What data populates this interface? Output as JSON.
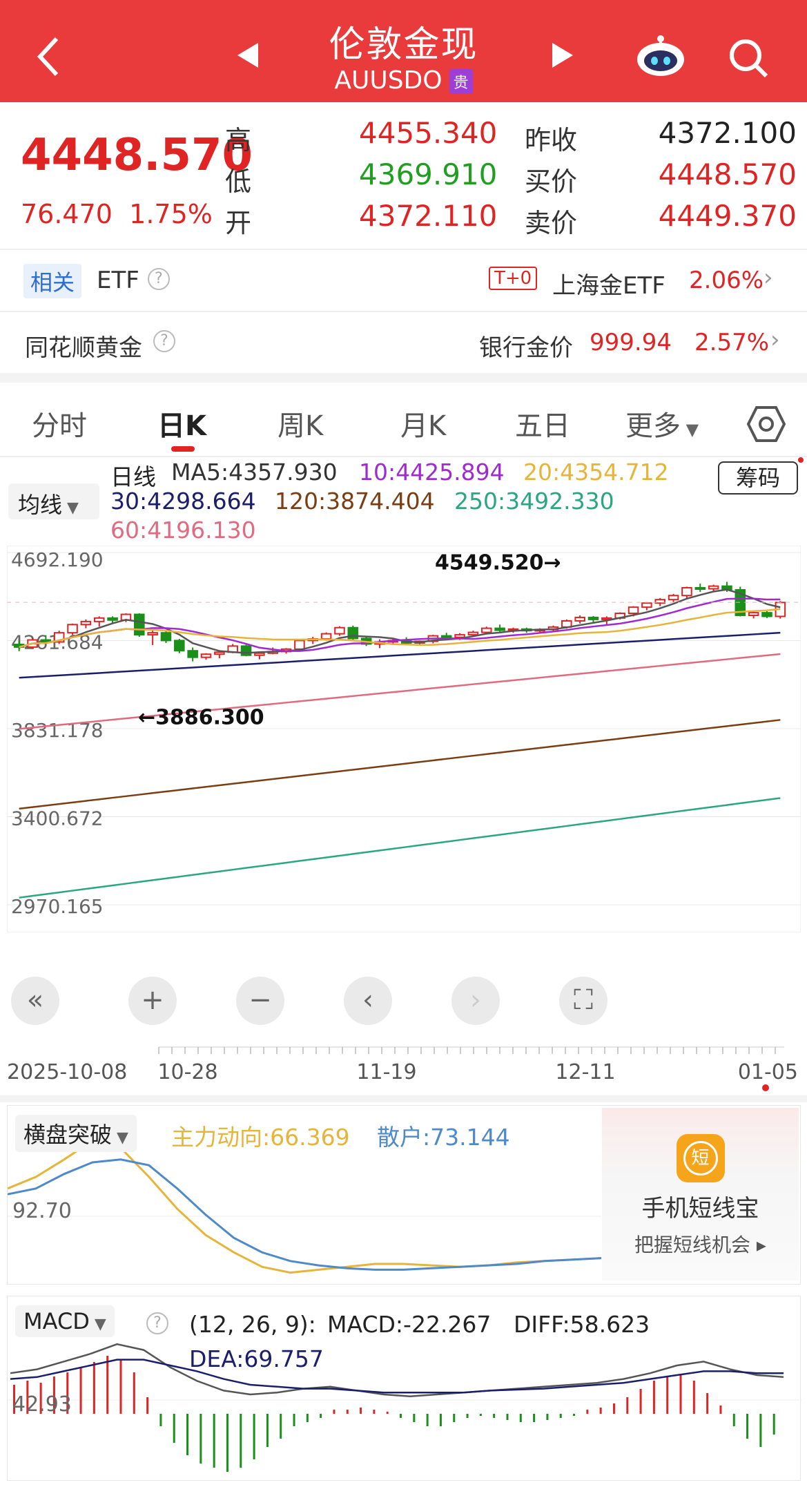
{
  "header": {
    "title": "伦敦金现",
    "code": "AUUSDO",
    "tag": "贵",
    "back_icon": "chevron-left",
    "prev_icon": "triangle-left",
    "next_icon": "triangle-right",
    "assistant_icon": "robot",
    "search_icon": "search"
  },
  "quote": {
    "price": "4448.570",
    "change": "76.470",
    "change_pct": "1.75%",
    "high_label": "高",
    "high": "4455.340",
    "low_label": "低",
    "low": "4369.910",
    "open_label": "开",
    "open": "4372.110",
    "prev_close_label": "昨收",
    "prev_close": "4372.100",
    "bid_label": "买价",
    "bid": "4448.570",
    "ask_label": "卖价",
    "ask": "4449.370"
  },
  "related": {
    "tag": "相关",
    "label": "ETF",
    "t0": "T+0",
    "etf_name": "上海金ETF",
    "etf_pct": "2.06%"
  },
  "gold": {
    "label": "同花顺黄金",
    "bank_label": "银行金价",
    "bank_price": "999.94",
    "bank_pct": "2.57%"
  },
  "tabs": [
    "分时",
    "日K",
    "周K",
    "月K",
    "五日",
    "更多"
  ],
  "active_tab": "日K",
  "ma": {
    "kind": "日线",
    "selector": "均线",
    "ma5": "MA5:4357.930",
    "ma10": "10:4425.894",
    "ma20": "20:4354.712",
    "ma30": "30:4298.664",
    "ma120": "120:3874.404",
    "ma250": "250:3492.330",
    "ma60": "60:4196.130",
    "chouma": "筹码"
  },
  "chart_data": {
    "type": "candlestick",
    "y_ticks": [
      "4692.190",
      "4261.684",
      "3831.178",
      "3400.672",
      "2970.165"
    ],
    "x_ticks": [
      "2025-10-08",
      "10-28",
      "11-19",
      "12-11",
      "01-05"
    ],
    "annotations": {
      "high": "4549.520→",
      "low": "←3886.300"
    },
    "ylim": [
      2970.165,
      4692.19
    ],
    "candles": [
      [
        4243,
        4260,
        4210,
        4230
      ],
      [
        4230,
        4275,
        4222,
        4265
      ],
      [
        4265,
        4288,
        4250,
        4255
      ],
      [
        4255,
        4310,
        4245,
        4300
      ],
      [
        4300,
        4345,
        4290,
        4340
      ],
      [
        4340,
        4365,
        4322,
        4355
      ],
      [
        4355,
        4380,
        4330,
        4372
      ],
      [
        4372,
        4380,
        4345,
        4362
      ],
      [
        4362,
        4395,
        4352,
        4390
      ],
      [
        4390,
        4395,
        4280,
        4290
      ],
      [
        4290,
        4310,
        4240,
        4300
      ],
      [
        4300,
        4310,
        4250,
        4262
      ],
      [
        4262,
        4270,
        4200,
        4212
      ],
      [
        4212,
        4228,
        4160,
        4180
      ],
      [
        4180,
        4200,
        4168,
        4195
      ],
      [
        4195,
        4215,
        4175,
        4205
      ],
      [
        4205,
        4245,
        4200,
        4235
      ],
      [
        4235,
        4245,
        4185,
        4190
      ],
      [
        4190,
        4205,
        4170,
        4200
      ],
      [
        4200,
        4228,
        4195,
        4208
      ],
      [
        4208,
        4225,
        4198,
        4220
      ],
      [
        4220,
        4270,
        4210,
        4262
      ],
      [
        4262,
        4280,
        4245,
        4270
      ],
      [
        4270,
        4302,
        4262,
        4295
      ],
      [
        4295,
        4332,
        4285,
        4325
      ],
      [
        4325,
        4335,
        4265,
        4272
      ],
      [
        4272,
        4285,
        4235,
        4245
      ],
      [
        4245,
        4268,
        4225,
        4255
      ],
      [
        4255,
        4272,
        4240,
        4262
      ],
      [
        4262,
        4278,
        4245,
        4250
      ],
      [
        4250,
        4262,
        4238,
        4258
      ],
      [
        4258,
        4290,
        4248,
        4285
      ],
      [
        4285,
        4300,
        4270,
        4278
      ],
      [
        4278,
        4298,
        4265,
        4290
      ],
      [
        4290,
        4310,
        4285,
        4302
      ],
      [
        4302,
        4330,
        4295,
        4322
      ],
      [
        4322,
        4340,
        4305,
        4312
      ],
      [
        4312,
        4325,
        4300,
        4318
      ],
      [
        4318,
        4325,
        4300,
        4310
      ],
      [
        4310,
        4322,
        4298,
        4316
      ],
      [
        4316,
        4335,
        4305,
        4328
      ],
      [
        4328,
        4365,
        4320,
        4358
      ],
      [
        4358,
        4385,
        4345,
        4375
      ],
      [
        4375,
        4382,
        4345,
        4365
      ],
      [
        4365,
        4380,
        4340,
        4372
      ],
      [
        4372,
        4400,
        4365,
        4395
      ],
      [
        4395,
        4430,
        4380,
        4425
      ],
      [
        4425,
        4450,
        4410,
        4445
      ],
      [
        4445,
        4470,
        4430,
        4462
      ],
      [
        4462,
        4490,
        4450,
        4482
      ],
      [
        4482,
        4525,
        4470,
        4520
      ],
      [
        4520,
        4540,
        4500,
        4515
      ],
      [
        4515,
        4535,
        4505,
        4528
      ],
      [
        4528,
        4549,
        4500,
        4510
      ],
      [
        4510,
        4525,
        4380,
        4385
      ],
      [
        4385,
        4410,
        4370,
        4398
      ],
      [
        4398,
        4410,
        4372,
        4380
      ],
      [
        4380,
        4455,
        4369,
        4448
      ]
    ],
    "ma5_color": "#555555",
    "ma10_color": "#a02ad2",
    "ma20_color": "#e7b43a",
    "ma30_color": "#1b1f6b",
    "ma60_color": "#e06a7f",
    "ma120_color": "#7a3e12",
    "ma250_color": "#2aa680",
    "up_color": "#e02424",
    "down_color": "#1a8f1a"
  },
  "controls": [
    "«",
    "+",
    "−",
    "‹",
    "›",
    "⛶"
  ],
  "indicator1": {
    "selector": "横盘突破",
    "main": "主力动向:66.369",
    "retail": "散户:73.144",
    "y_tick": "92.70",
    "main_color": "#e7b43a",
    "retail_color": "#4e8ac9",
    "main_values": [
      62,
      70,
      82,
      95,
      90,
      70,
      48,
      30,
      18,
      8,
      4,
      6,
      8,
      10,
      10,
      9,
      8,
      9,
      11,
      12,
      13,
      14
    ],
    "retail_values": [
      58,
      62,
      72,
      80,
      82,
      78,
      62,
      44,
      28,
      18,
      12,
      9,
      7,
      6,
      6,
      7,
      8,
      9,
      10,
      12,
      13,
      14
    ]
  },
  "promo": {
    "icon_text": "短",
    "title": "手机短线宝",
    "subtitle": "把握短线机会 ▸"
  },
  "macd": {
    "selector": "MACD",
    "params": "(12, 26, 9):",
    "macd": "MACD:-22.267",
    "diff": "DIFF:58.623",
    "dea": "DEA:69.757",
    "y_tick": "42.93",
    "diff_color": "#555555",
    "dea_color": "#1b1f6b",
    "bars": [
      14,
      16,
      15,
      18,
      20,
      22,
      25,
      28,
      26,
      20,
      8,
      -6,
      -14,
      -20,
      -24,
      -26,
      -28,
      -26,
      -22,
      -16,
      -12,
      -6,
      -4,
      -2,
      2,
      2,
      3,
      2,
      1,
      -2,
      -4,
      -6,
      -6,
      -4,
      -2,
      -1,
      -2,
      -3,
      -4,
      -4,
      -3,
      -2,
      -1,
      2,
      3,
      5,
      8,
      12,
      16,
      18,
      19,
      16,
      10,
      4,
      -6,
      -12,
      -16,
      -10
    ],
    "diff_values": [
      42,
      46,
      54,
      62,
      72,
      66,
      48,
      34,
      24,
      20,
      22,
      26,
      28,
      24,
      20,
      18,
      20,
      22,
      24,
      26,
      28,
      30,
      32,
      36,
      42,
      50,
      54,
      46,
      40,
      38
    ],
    "dea_values": [
      36,
      38,
      44,
      50,
      56,
      56,
      50,
      44,
      36,
      30,
      28,
      26,
      26,
      24,
      22,
      22,
      22,
      22,
      24,
      25,
      26,
      28,
      30,
      32,
      36,
      40,
      44,
      44,
      42,
      42
    ]
  }
}
